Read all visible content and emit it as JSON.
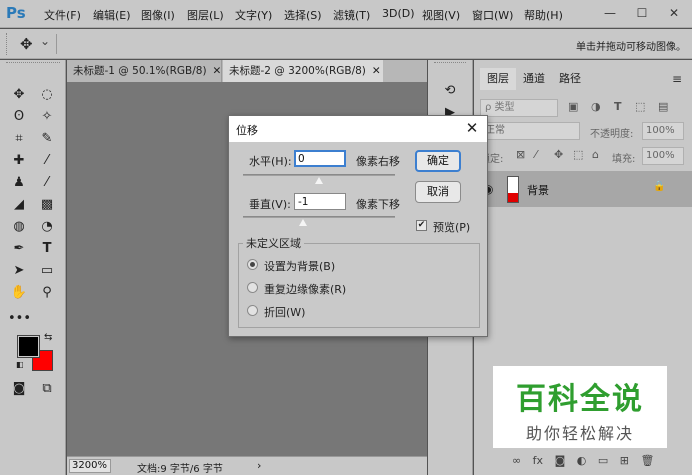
{
  "app": {
    "logo": "Ps",
    "menu": [
      "文件(F)",
      "编辑(E)",
      "图像(I)",
      "图层(L)",
      "文字(Y)",
      "选择(S)",
      "滤镜(T)",
      "3D(D)",
      "视图(V)",
      "窗口(W)",
      "帮助(H)"
    ],
    "window_controls": {
      "minimize": "—",
      "maximize": "☐",
      "close": "✕"
    }
  },
  "options_bar": {
    "move_tool": "✥",
    "dropdown": "⌄",
    "hint": "单击并拖动可移动图像。"
  },
  "tabs": [
    {
      "label": "未标题-1 @ 50.1%(RGB/8)",
      "close": "✕"
    },
    {
      "label": "未标题-2 @ 3200%(RGB/8)",
      "close": "✕"
    }
  ],
  "status": {
    "zoom": "3200%",
    "doc_info": "文档:9 字节/6 字节",
    "arrow": "›"
  },
  "layers_panel": {
    "tabs": [
      "图层",
      "通道",
      "路径"
    ],
    "menu": "≡",
    "kind_filter": "ρ 类型",
    "blend_mode": "正常",
    "opacity_label": "不透明度:",
    "opacity_value": "100%",
    "lock_label": "锁定:",
    "fill_label": "填充:",
    "fill_value": "100%",
    "layer_name": "背景",
    "lock_icon": "🔒"
  },
  "dialog": {
    "title": "位移",
    "close": "✕",
    "horizontal_label": "水平(H):",
    "horizontal_value": "0",
    "horizontal_unit": "像素右移",
    "vertical_label": "垂直(V):",
    "vertical_value": "-1",
    "vertical_unit": "像素下移",
    "ok": "确定",
    "cancel": "取消",
    "preview_label": "预览(P)",
    "preview_check": "✔",
    "undefined_area_title": "未定义区域",
    "options": [
      "设置为背景(B)",
      "重复边缘像素(R)",
      "折回(W)"
    ]
  },
  "colors": {
    "foreground": "#000000",
    "background": "#ff0000",
    "accent": "#3c7fd0"
  },
  "watermark": {
    "main": "百科全说",
    "sub": "助你轻松解决"
  }
}
